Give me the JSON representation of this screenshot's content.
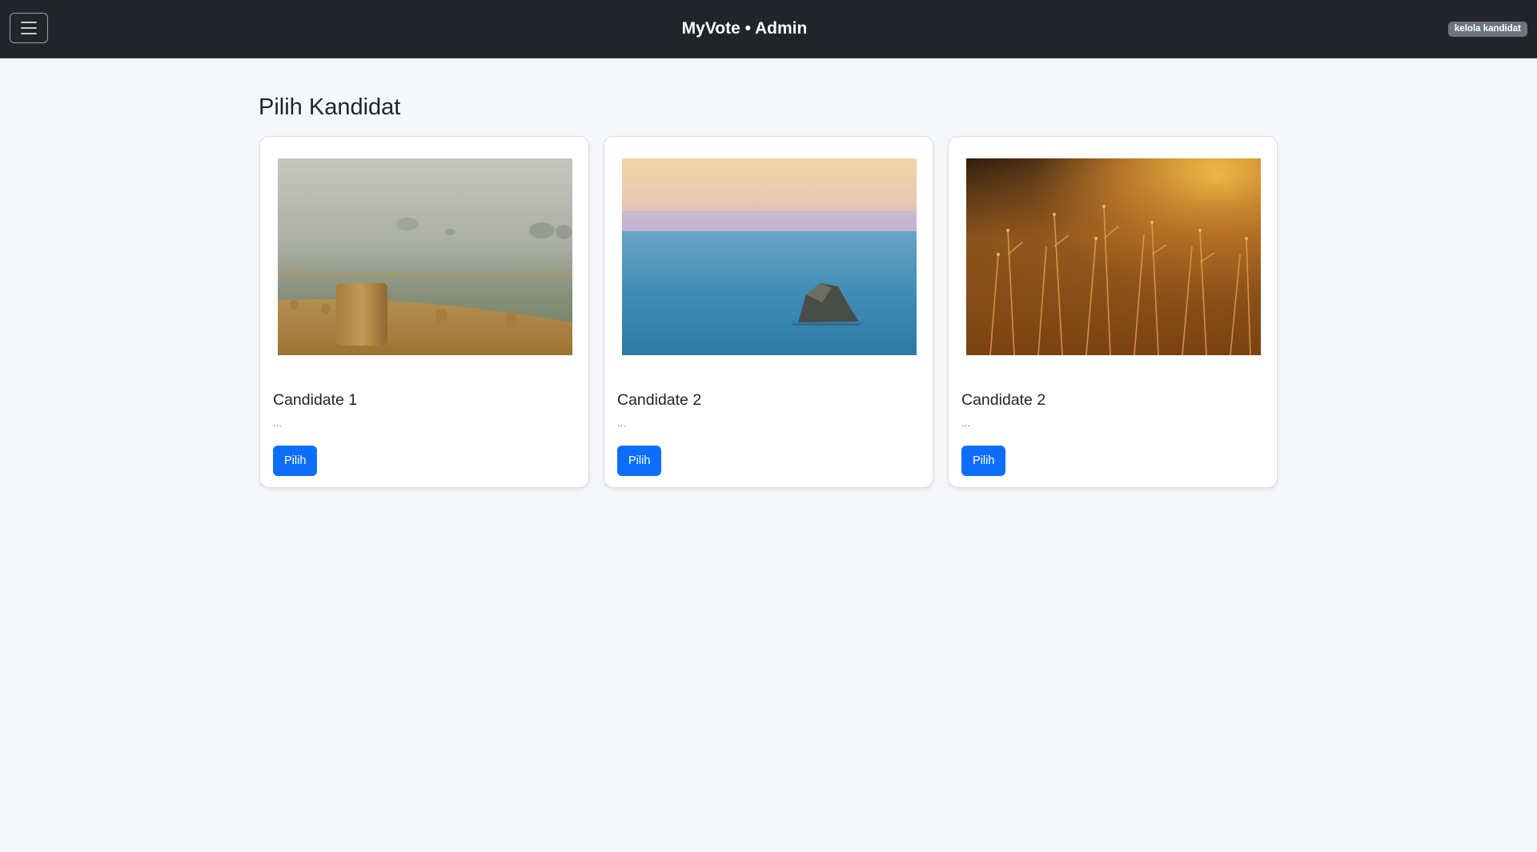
{
  "navbar": {
    "toggle_icon": "hamburger-menu-icon",
    "brand": "MyVote • Admin",
    "badge": "kelola kandidat"
  },
  "page": {
    "title": "Pilih Kandidat"
  },
  "candidates": [
    {
      "name": "Candidate 1",
      "description": "...",
      "button_label": "Pilih",
      "photo": "misty field with hay bales"
    },
    {
      "name": "Candidate 2",
      "description": "...",
      "button_label": "Pilih",
      "photo": "sea with rock at sunset"
    },
    {
      "name": "Candidate 2",
      "description": "...",
      "button_label": "Pilih",
      "photo": "golden grass in sunlight"
    }
  ],
  "colors": {
    "navbar": "#212529",
    "background": "#f6f7fa",
    "primary": "#0d6efd",
    "badge": "#6c757d"
  }
}
